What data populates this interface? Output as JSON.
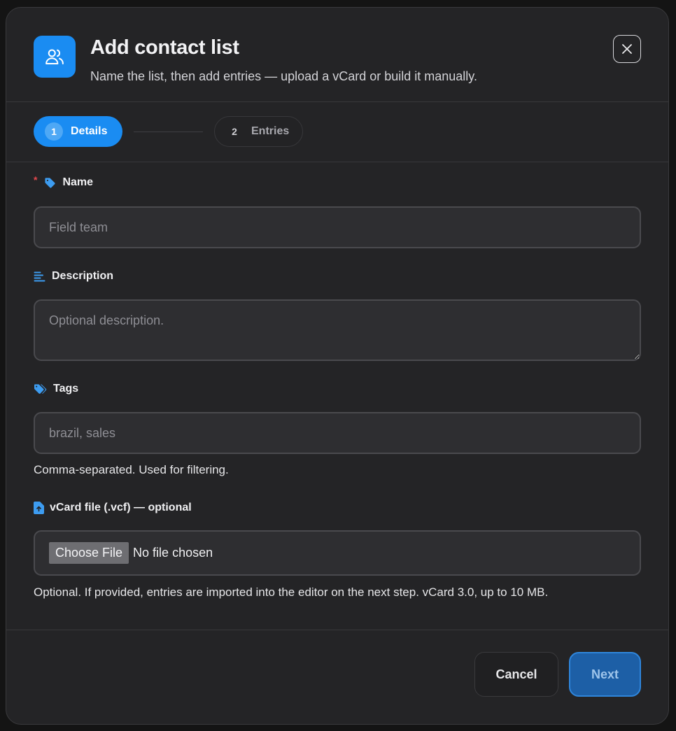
{
  "header": {
    "title": "Add contact list",
    "subtitle": "Name the list, then add entries — upload a vCard or build it manually.",
    "icon": "users-icon",
    "close_icon": "close-icon"
  },
  "stepper": {
    "steps": [
      {
        "number": "1",
        "label": "Details",
        "state": "active"
      },
      {
        "number": "2",
        "label": "Entries",
        "state": "inactive"
      }
    ]
  },
  "form": {
    "name": {
      "label": "Name",
      "required_marker": "*",
      "placeholder": "Field team",
      "value": "",
      "icon": "tag-icon"
    },
    "description": {
      "label": "Description",
      "placeholder": "Optional description.",
      "value": "",
      "icon": "align-left-icon"
    },
    "tags": {
      "label": "Tags",
      "placeholder": "brazil, sales",
      "value": "",
      "hint": "Comma-separated. Used for filtering.",
      "icon": "tags-icon"
    },
    "vcard": {
      "label": "vCard file (.vcf) — optional",
      "choose_label": "Choose File",
      "no_file_text": "No file chosen",
      "hint": "Optional. If provided, entries are imported into the editor on the next step. vCard 3.0, up to 10 MB.",
      "icon": "file-upload-icon"
    }
  },
  "footer": {
    "cancel_label": "Cancel",
    "next_label": "Next"
  },
  "colors": {
    "accent": "#1a8cf2",
    "required": "#e5484d",
    "modal_bg": "#242426",
    "input_bg": "#2e2e31"
  }
}
